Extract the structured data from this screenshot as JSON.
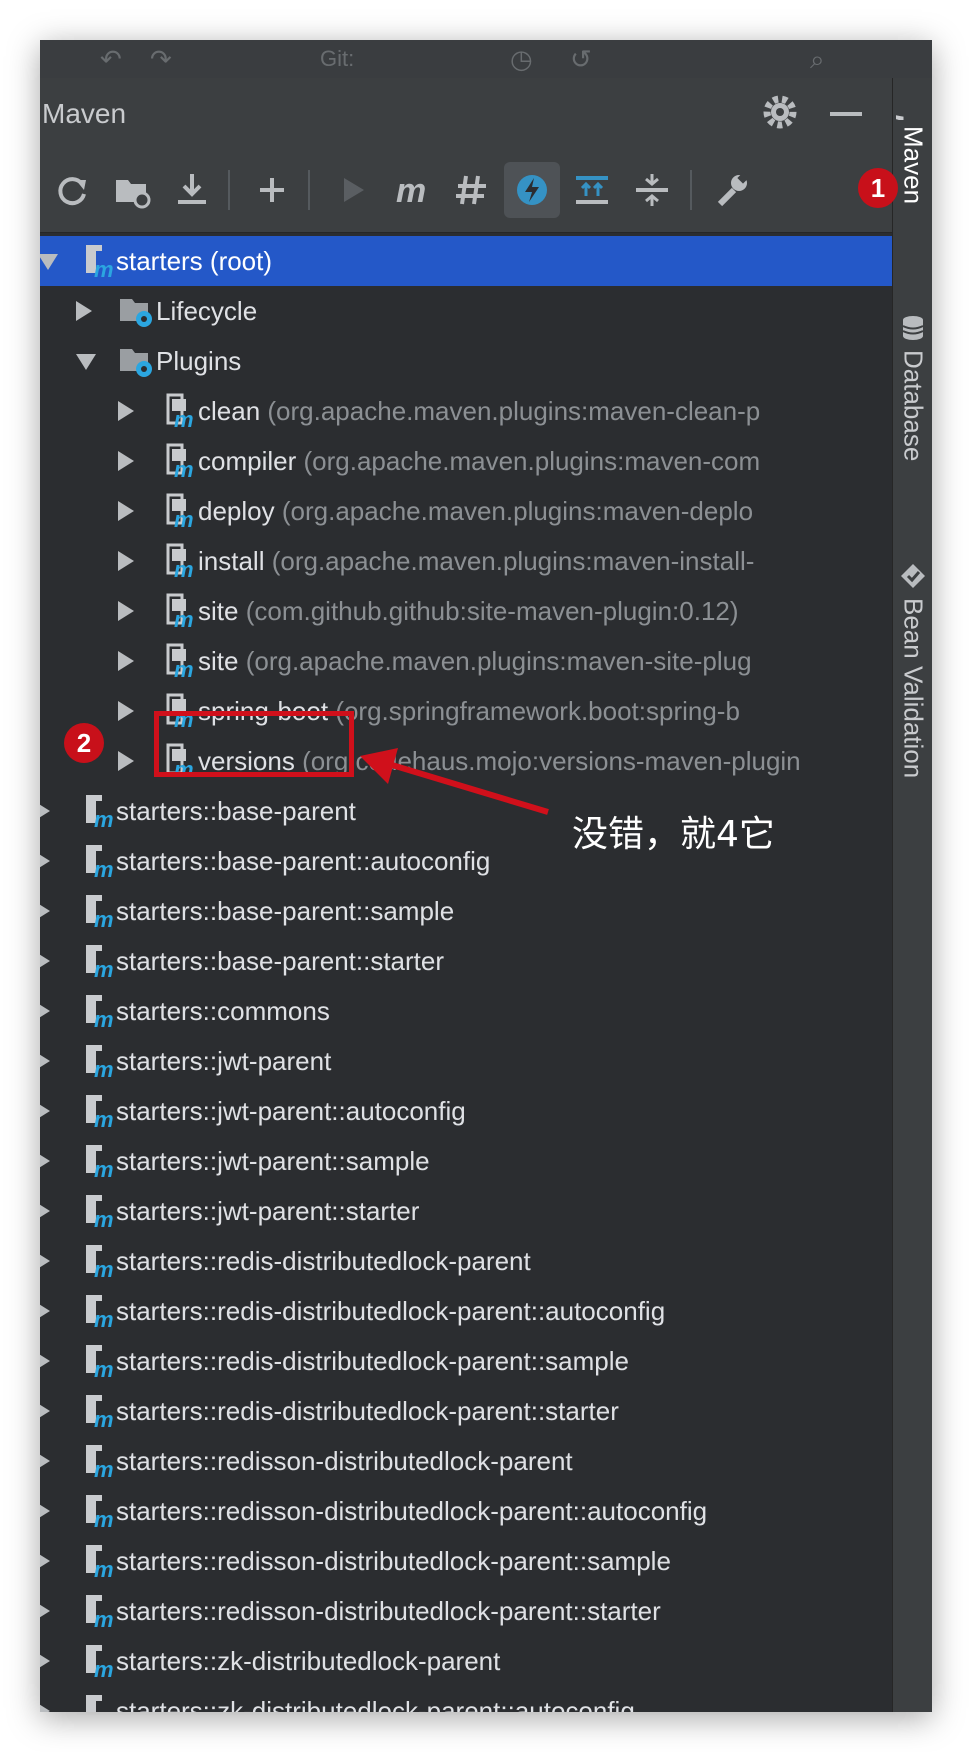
{
  "top_ghost_text": "Git:",
  "panel": {
    "title": "Maven"
  },
  "right_tabs": [
    {
      "label": "Maven",
      "icon": "maven-m-icon"
    },
    {
      "label": "Database",
      "icon": "database-icon"
    },
    {
      "label": "Bean Validation",
      "icon": "bean-validation-icon"
    }
  ],
  "toolbar": {
    "tools": [
      {
        "name": "reload-icon"
      },
      {
        "name": "generate-sources-icon"
      },
      {
        "name": "download-icon"
      },
      {
        "name": "add-icon"
      },
      {
        "name": "run-icon"
      },
      {
        "name": "execute-goal-icon"
      },
      {
        "name": "toggle-offline-icon"
      },
      {
        "name": "skip-tests-icon"
      },
      {
        "name": "show-dependencies-icon"
      },
      {
        "name": "collapse-all-icon"
      },
      {
        "name": "settings-wrench-icon"
      }
    ]
  },
  "tree": {
    "root": {
      "label": "starters (root)"
    },
    "lifecycle": {
      "label": "Lifecycle"
    },
    "plugins": {
      "label": "Plugins"
    },
    "plugin_items": [
      {
        "name": "clean",
        "detail": "(org.apache.maven.plugins:maven-clean-p"
      },
      {
        "name": "compiler",
        "detail": "(org.apache.maven.plugins:maven-com"
      },
      {
        "name": "deploy",
        "detail": "(org.apache.maven.plugins:maven-deplo"
      },
      {
        "name": "install",
        "detail": "(org.apache.maven.plugins:maven-install-"
      },
      {
        "name": "site",
        "detail": "(com.github.github:site-maven-plugin:0.12)"
      },
      {
        "name": "site",
        "detail": "(org.apache.maven.plugins:maven-site-plug"
      },
      {
        "name": "spring-boot",
        "detail": "(org.springframework.boot:spring-b"
      },
      {
        "name": "versions",
        "detail": "(org.codehaus.mojo:versions-maven-plugin"
      }
    ],
    "modules": [
      "starters::base-parent",
      "starters::base-parent::autoconfig",
      "starters::base-parent::sample",
      "starters::base-parent::starter",
      "starters::commons",
      "starters::jwt-parent",
      "starters::jwt-parent::autoconfig",
      "starters::jwt-parent::sample",
      "starters::jwt-parent::starter",
      "starters::redis-distributedlock-parent",
      "starters::redis-distributedlock-parent::autoconfig",
      "starters::redis-distributedlock-parent::sample",
      "starters::redis-distributedlock-parent::starter",
      "starters::redisson-distributedlock-parent",
      "starters::redisson-distributedlock-parent::autoconfig",
      "starters::redisson-distributedlock-parent::sample",
      "starters::redisson-distributedlock-parent::starter",
      "starters::zk-distributedlock-parent",
      "starters::zk-distributedlock-parent::autoconfig"
    ]
  },
  "annotations": {
    "badge1": "1",
    "badge2": "2",
    "callout": "没错，就4它",
    "accent_red": "#d0101b",
    "selection_blue": "#2458c8"
  }
}
